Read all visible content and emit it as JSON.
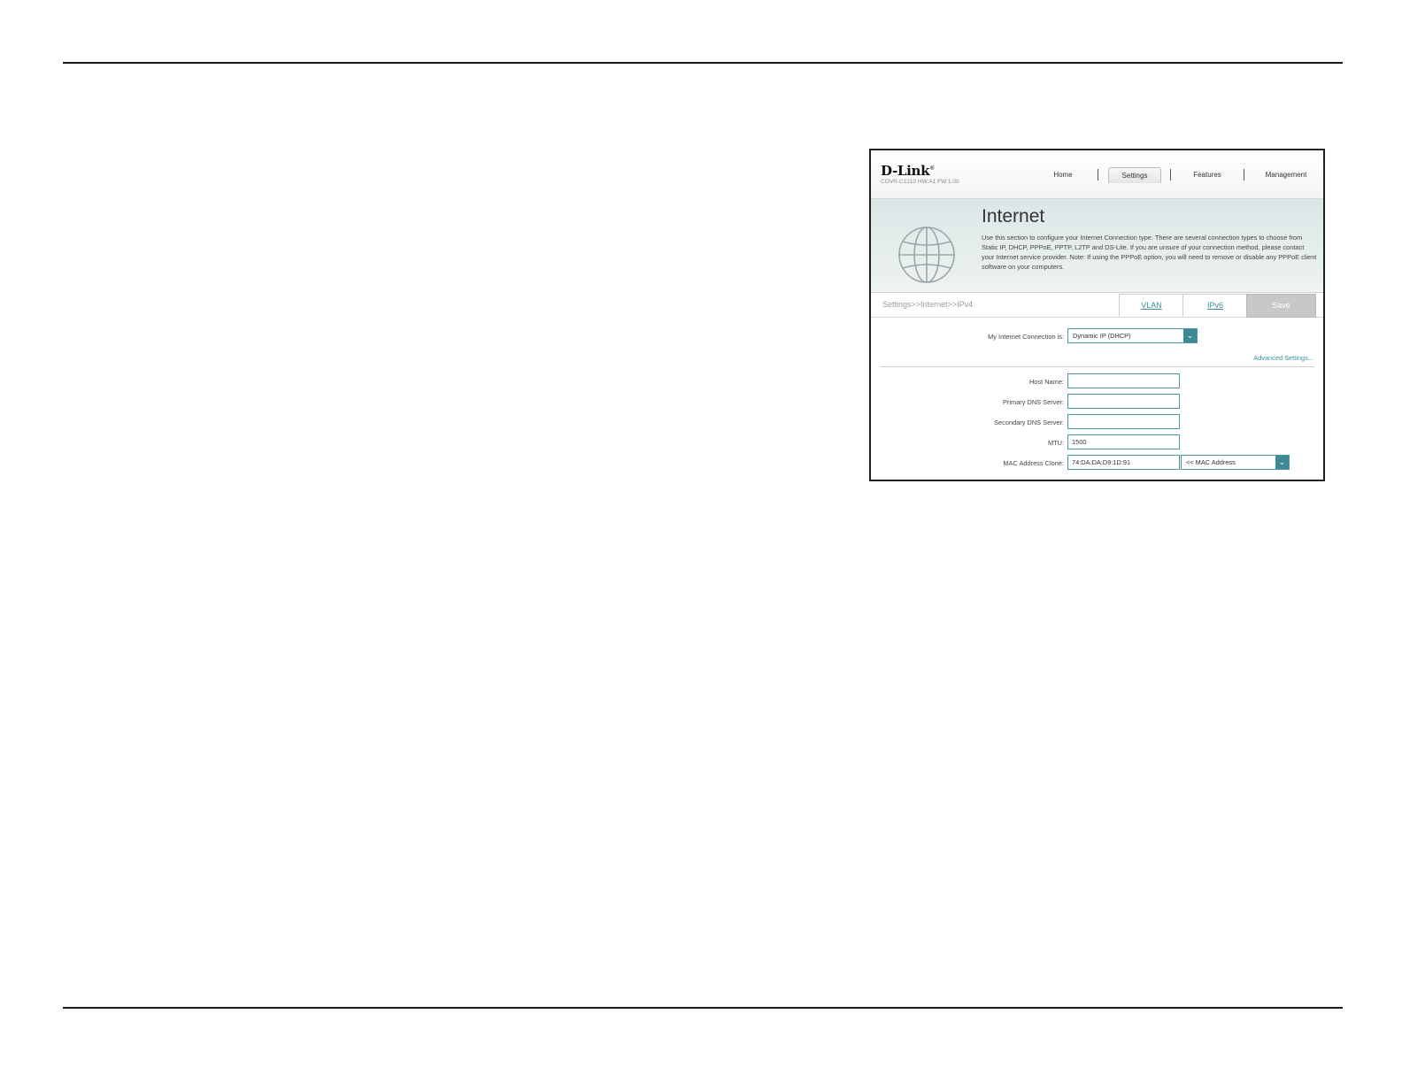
{
  "router": {
    "brand": "D-Link",
    "brand_mark": "®",
    "model": "COVR-C1210 HW:A1 FW:1.00",
    "nav": {
      "home": "Home",
      "settings": "Settings",
      "features": "Features",
      "management": "Management",
      "active": "Settings"
    },
    "banner": {
      "title": "Internet",
      "description": "Use this section to configure your Internet Connection type. There are several connection types to choose from Static IP, DHCP, PPPoE, PPTP, L2TP and DS-Lite. If you are unsure of your connection method, please contact your Internet service provider. Note: If using the PPPoE option, you will need to remove or disable any PPPoE client software on your computers.",
      "icon": "globe-icon"
    },
    "breadcrumb": "Settings>>Internet>>IPv4",
    "tabs": {
      "vlan": "VLAN",
      "ipv6": "IPv6",
      "save": "Save"
    },
    "form": {
      "connection_label": "My Internet Connection is:",
      "connection_value": "Dynamic IP (DHCP)",
      "advanced_link": "Advanced Settings...",
      "host_name_label": "Host Name:",
      "host_name_value": "",
      "primary_dns_label": "Primary DNS Server:",
      "primary_dns_value": "",
      "secondary_dns_label": "Secondary DNS Server:",
      "secondary_dns_value": "",
      "mtu_label": "MTU:",
      "mtu_value": "1500",
      "mac_label": "MAC Address Clone:",
      "mac_value": "74:DA:DA:D9:1D:91",
      "mac_select_value": "<< MAC Address"
    },
    "colors": {
      "accent": "#3d8a96",
      "link": "#3a8f9a",
      "save_disabled": "#c8c8c8"
    }
  }
}
